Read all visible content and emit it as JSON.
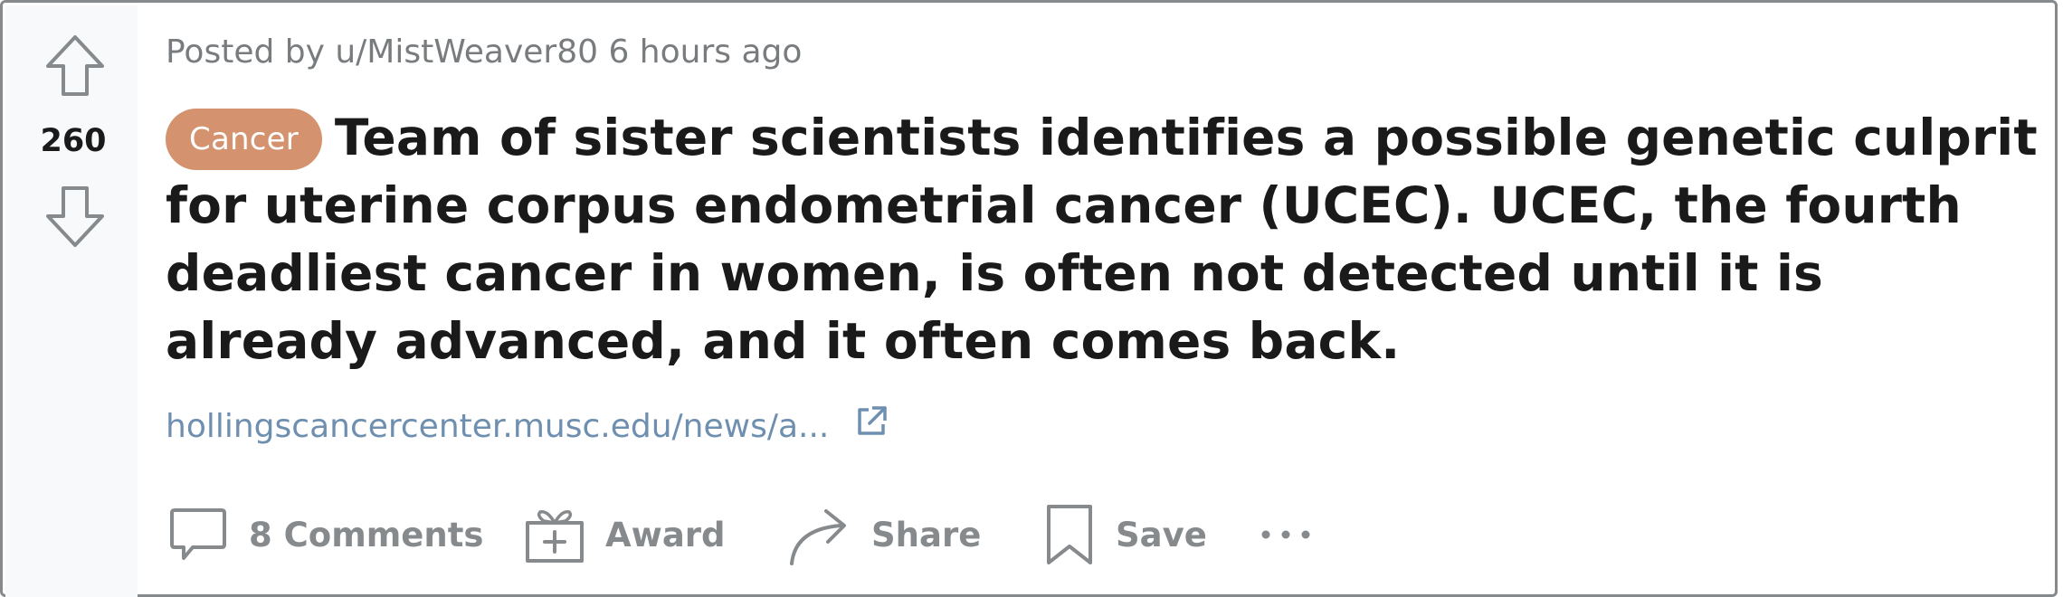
{
  "vote": {
    "score": "260",
    "upvote_icon": "arrow-up-outline-icon",
    "downvote_icon": "arrow-down-outline-icon"
  },
  "post": {
    "meta": "Posted by u/MistWeaver80 6 hours ago",
    "flair": {
      "label": "Cancer",
      "color": "#d4936e"
    },
    "title": "Team of sister scientists identifies a possible genetic culprit for uterine corpus endometrial cancer (UCEC). UCEC, the fourth deadliest cancer in women, is often not detected until it is already advanced, and it often comes back.",
    "link_text": "hollingscancercenter.musc.edu/news/a...",
    "link_icon": "external-link-icon"
  },
  "actions": {
    "comments": {
      "label": "8 Comments",
      "icon": "comment-bubble-icon"
    },
    "award": {
      "label": "Award",
      "icon": "gift-icon"
    },
    "share": {
      "label": "Share",
      "icon": "share-arrow-icon"
    },
    "save": {
      "label": "Save",
      "icon": "bookmark-icon"
    },
    "more": {
      "label": "···",
      "icon": "more-options-icon"
    }
  },
  "colors": {
    "meta_text": "#787c7e",
    "link": "#6e8fb0",
    "action_text": "#878a8c",
    "title_text": "#1a1a1b",
    "vote_column_bg": "#f8f9fa",
    "border": "#878a8c"
  }
}
